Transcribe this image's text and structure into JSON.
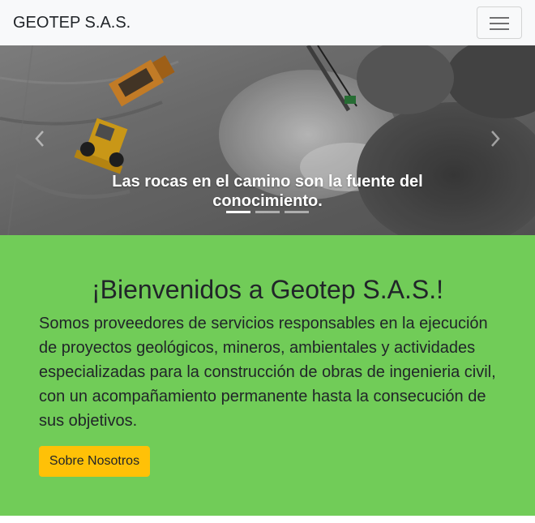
{
  "navbar": {
    "brand": "GEOTEP S.A.S.",
    "toggler_icon": "hamburger-menu-icon"
  },
  "carousel": {
    "caption": "Las rocas en el camino son la fuente del conocimiento.",
    "slide_count": 3,
    "active_slide": 1,
    "prev_icon": "chevron-left-icon",
    "next_icon": "chevron-right-icon"
  },
  "welcome": {
    "title": "¡Bienvenidos a Geotep S.A.S.!",
    "text": "Somos proveedores de servicios responsables en la ejecución de proyectos geológicos, mineros, ambientales y actividades especializadas para la construcción de obras de ingenieria civil, con un acompañamiento permanente hasta la consecución de sus objetivos.",
    "button_label": "Sobre Nosotros"
  },
  "colors": {
    "navbar_bg": "#f8f9fa",
    "welcome_bg": "#71cc58",
    "button_bg": "#ffc107"
  }
}
